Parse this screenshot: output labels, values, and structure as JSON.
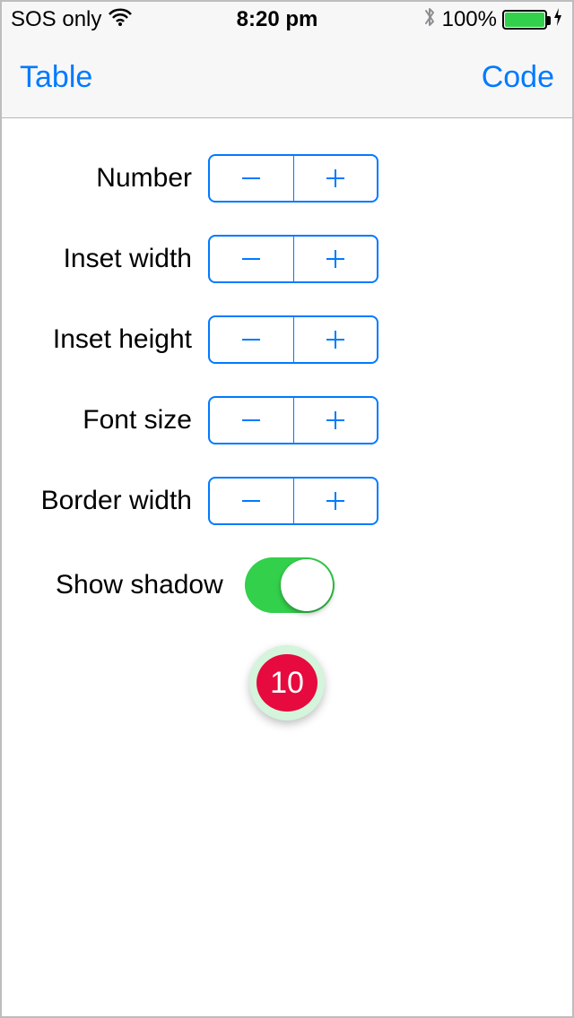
{
  "status": {
    "carrier": "SOS only",
    "time": "8:20 pm",
    "battery_pct": "100%"
  },
  "nav": {
    "left": "Table",
    "right": "Code"
  },
  "controls": {
    "number_label": "Number",
    "inset_width_label": "Inset width",
    "inset_height_label": "Inset height",
    "font_size_label": "Font size",
    "border_width_label": "Border width",
    "show_shadow_label": "Show shadow",
    "show_shadow_value": true
  },
  "badge": {
    "value": "10"
  },
  "colors": {
    "accent": "#007aff",
    "switch_on": "#33d14b",
    "badge_bg": "#e60a3e",
    "badge_halo": "#d4f4dc"
  }
}
